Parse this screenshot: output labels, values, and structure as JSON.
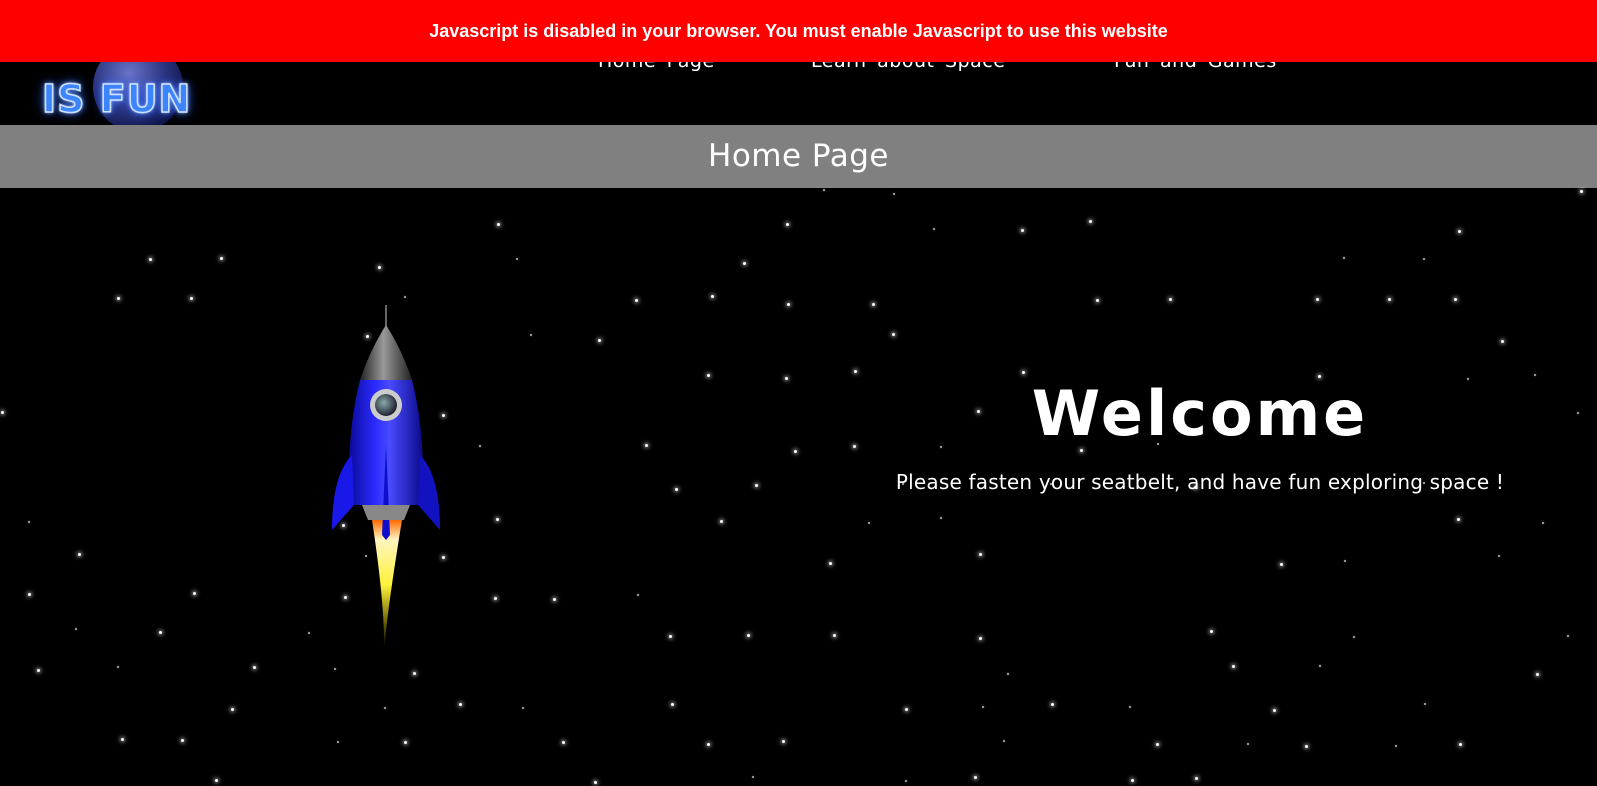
{
  "banner": {
    "warning_text": "Javascript is disabled in your browser. You must enable Javascript to use this website",
    "background_color": "#ff0000"
  },
  "header": {
    "logo_text": "IS FUN",
    "nav": [
      {
        "label": "Home Page"
      },
      {
        "label": "Learn about Space"
      },
      {
        "label": "Fun and Games"
      }
    ]
  },
  "page_title": "Home Page",
  "hero": {
    "welcome_title": "Welcome",
    "welcome_subtitle": "Please fasten your seatbelt, and have fun exploring space !"
  },
  "icons": {
    "rocket": "rocket-icon",
    "planet": "planet-icon"
  },
  "colors": {
    "background": "#000000",
    "title_band": "#808080",
    "rocket_body": "#1a1aff",
    "flame": "#ffee33"
  }
}
